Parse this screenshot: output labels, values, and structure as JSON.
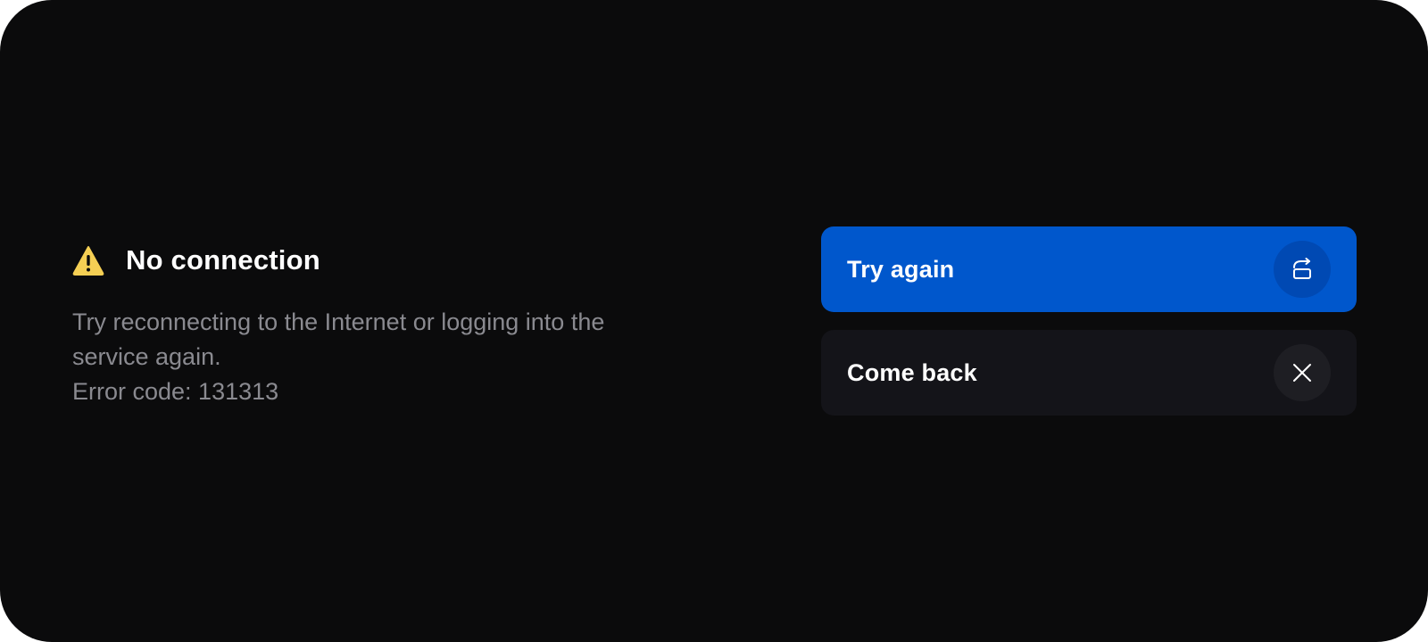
{
  "colors": {
    "background": "#0b0b0c",
    "accent": "#0057cc",
    "warning": "#f5cf54",
    "text_primary": "#ffffff",
    "text_secondary": "#8a8a90"
  },
  "error": {
    "icon": "warning-icon",
    "title": "No connection",
    "description_line1": "Try reconnecting to the Internet or logging into the",
    "description_line2": "service again.",
    "error_code": "Error code: 131313"
  },
  "actions": {
    "retry": {
      "label": "Try again",
      "icon": "retry-icon"
    },
    "back": {
      "label": "Come back",
      "icon": "close-icon"
    }
  }
}
